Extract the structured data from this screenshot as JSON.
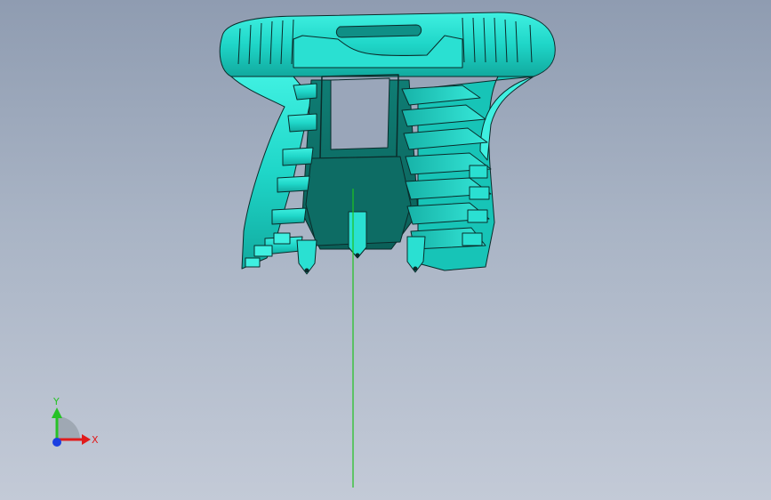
{
  "viewport": {
    "background_top": "#8f9cb1",
    "background_bottom": "#c3cad7"
  },
  "model": {
    "color_face": "#1fd6c8",
    "color_shade": "#0f8f86",
    "color_dark": "#08504b",
    "edge_color": "#0a2b2a"
  },
  "pivot_axis": {
    "color": "#1fc21f"
  },
  "triad": {
    "x_label": "X",
    "y_label": "Y",
    "x_color": "#e11b1b",
    "y_color": "#27c227",
    "z_color": "#1b3fe1"
  }
}
